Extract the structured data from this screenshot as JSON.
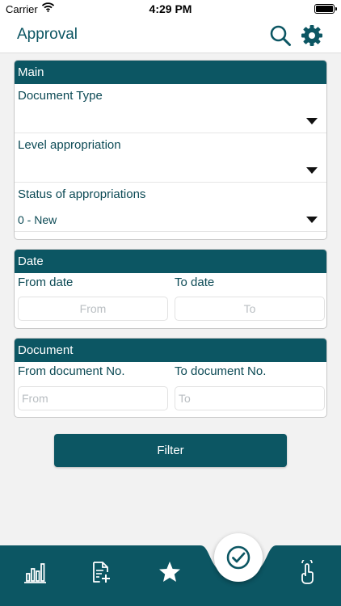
{
  "status_bar": {
    "carrier": "Carrier",
    "time": "4:29 PM"
  },
  "header": {
    "title": "Approval",
    "icons": [
      "search-icon",
      "gear-icon"
    ]
  },
  "main_section": {
    "title": "Main",
    "fields": [
      {
        "label": "Document Type",
        "value": ""
      },
      {
        "label": "Level appropriation",
        "value": ""
      },
      {
        "label": "Status of appropriations",
        "value": "0 - New"
      }
    ]
  },
  "date_section": {
    "title": "Date",
    "from_label": "From date",
    "to_label": "To date",
    "from_placeholder": "From",
    "to_placeholder": "To"
  },
  "document_section": {
    "title": "Document",
    "from_label": "From document No.",
    "to_label": "To document No.",
    "from_placeholder": "From",
    "to_placeholder": "To"
  },
  "filter_button": {
    "label": "Filter"
  },
  "tab_bar": {
    "items": [
      "bar-chart-icon",
      "add-document-icon",
      "star-icon",
      "approval-check-icon",
      "touch-hand-icon"
    ],
    "active": "approval-check-icon"
  },
  "colors": {
    "primary": "#0c5663",
    "background": "#f2f2f2",
    "card": "#ffffff"
  }
}
